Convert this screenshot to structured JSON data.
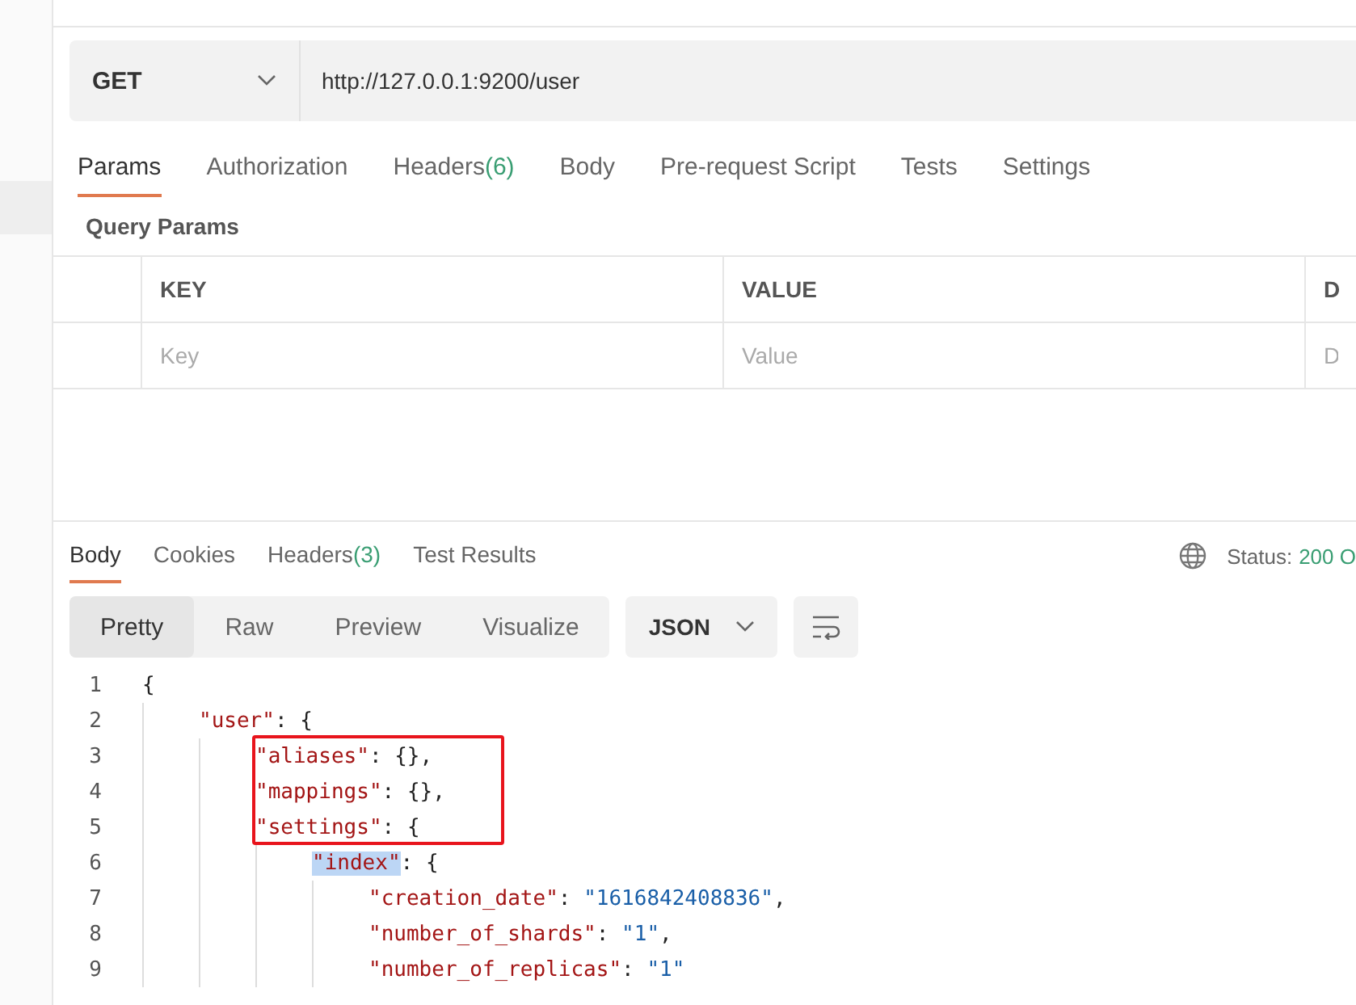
{
  "request": {
    "method": "GET",
    "url": "http://127.0.0.1:9200/user"
  },
  "request_tabs": [
    {
      "label": "Params",
      "selected": true
    },
    {
      "label": "Authorization",
      "selected": false
    },
    {
      "label": "Headers",
      "count": "(6)",
      "selected": false
    },
    {
      "label": "Body",
      "selected": false
    },
    {
      "label": "Pre-request Script",
      "selected": false
    },
    {
      "label": "Tests",
      "selected": false
    },
    {
      "label": "Settings",
      "selected": false
    }
  ],
  "query_params": {
    "title": "Query Params",
    "columns": [
      "KEY",
      "VALUE",
      "D"
    ],
    "placeholders": [
      "Key",
      "Value",
      "D"
    ]
  },
  "response_tabs": [
    {
      "label": "Body",
      "selected": true
    },
    {
      "label": "Cookies",
      "selected": false
    },
    {
      "label": "Headers",
      "count": "(3)",
      "selected": false
    },
    {
      "label": "Test Results",
      "selected": false
    }
  ],
  "status": {
    "label": "Status:",
    "value": "200 O"
  },
  "view_modes": [
    {
      "label": "Pretty",
      "selected": true
    },
    {
      "label": "Raw",
      "selected": false
    },
    {
      "label": "Preview",
      "selected": false
    },
    {
      "label": "Visualize",
      "selected": false
    }
  ],
  "format": "JSON",
  "code": [
    {
      "number": "1",
      "value": "{",
      "kind": "brace",
      "children": [
        {
          "number": "2",
          "key": "\"user\"",
          "sep": ": ",
          "value": "{",
          "kind": "brace",
          "children": [
            {
              "number": "3",
              "key": "\"aliases\"",
              "sep": ": ",
              "value": "{},",
              "kind": "brace",
              "boxed": true
            },
            {
              "number": "4",
              "key": "\"mappings\"",
              "sep": ": ",
              "value": "{},",
              "kind": "brace",
              "boxed": true
            },
            {
              "number": "5",
              "key": "\"settings\"",
              "sep": ": ",
              "value": "{",
              "kind": "brace",
              "boxed": true,
              "children": [
                {
                  "number": "6",
                  "key": "\"index\"",
                  "selected": true,
                  "sep": ": ",
                  "value": "{",
                  "kind": "brace",
                  "children": [
                    {
                      "number": "7",
                      "key": "\"creation_date\"",
                      "sep": ": ",
                      "value": "\"1616842408836\"",
                      "kind": "string",
                      "tail": ","
                    },
                    {
                      "number": "8",
                      "key": "\"number_of_shards\"",
                      "sep": ": ",
                      "value": "\"1\"",
                      "kind": "string",
                      "tail": ","
                    },
                    {
                      "number": "9",
                      "key": "\"number_of_replicas\"",
                      "sep": ": ",
                      "value": "\"1\"",
                      "kind": "string"
                    }
                  ]
                }
              ]
            }
          ]
        }
      ]
    }
  ]
}
